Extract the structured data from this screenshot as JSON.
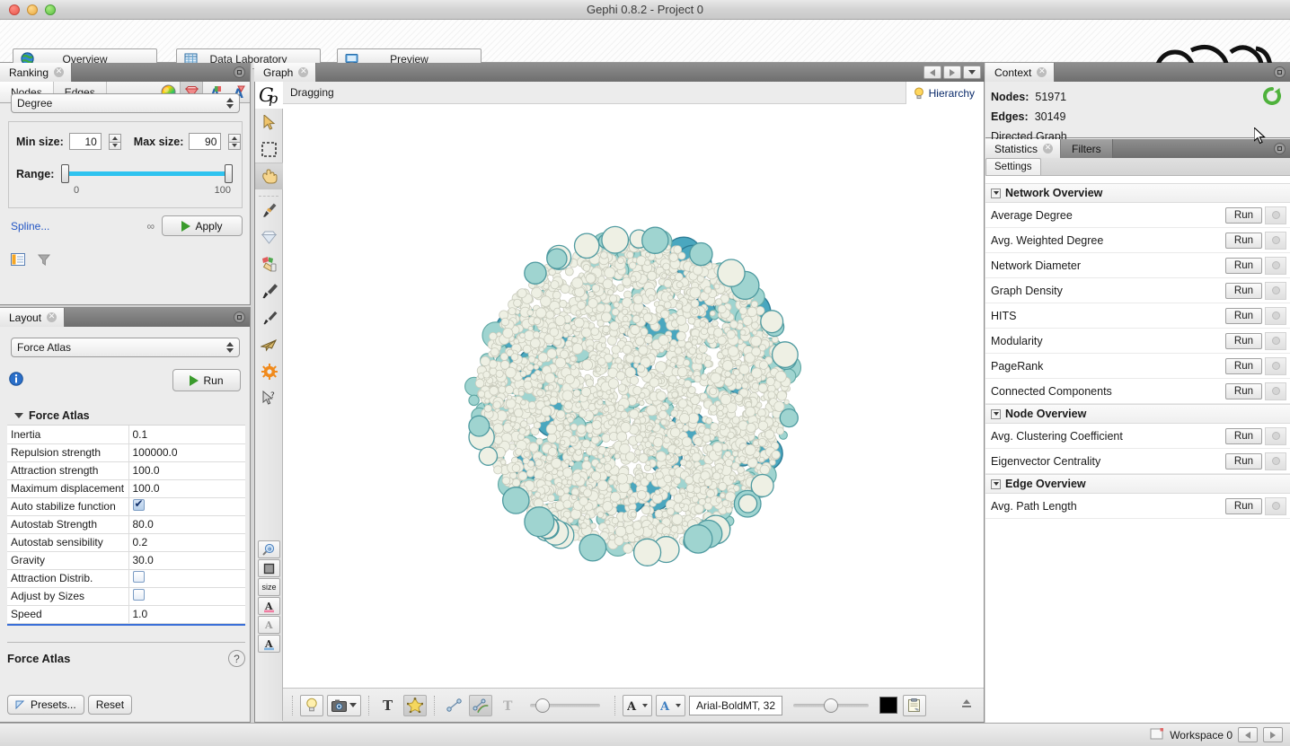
{
  "window": {
    "title": "Gephi 0.8.2 - Project 0"
  },
  "toolbar": {
    "modes": [
      {
        "label": "Overview",
        "icon": "globe-icon"
      },
      {
        "label": "Data Laboratory",
        "icon": "table-icon"
      },
      {
        "label": "Preview",
        "icon": "monitor-icon"
      }
    ]
  },
  "ranking": {
    "tab_label": "Ranking",
    "subtabs": [
      {
        "label": "Nodes",
        "selected": true
      },
      {
        "label": "Edges",
        "selected": false
      }
    ],
    "icons": [
      {
        "name": "color-wheel-icon",
        "active": false
      },
      {
        "name": "diamond-size-icon",
        "active": true
      },
      {
        "name": "label-color-icon",
        "active": false
      },
      {
        "name": "label-size-icon",
        "active": false
      }
    ],
    "attribute": "Degree",
    "min_size_label": "Min size:",
    "min_size_value": "10",
    "max_size_label": "Max size:",
    "max_size_value": "90",
    "range_label": "Range:",
    "range_min": "0",
    "range_max": "100",
    "spline_label": "Spline...",
    "apply_label": "Apply"
  },
  "layout": {
    "tab_label": "Layout",
    "algorithm": "Force Atlas",
    "run_label": "Run",
    "group_label": "Force Atlas",
    "properties": [
      {
        "key": "Inertia",
        "value": "0.1",
        "type": "text"
      },
      {
        "key": "Repulsion strength",
        "value": "100000.0",
        "type": "text"
      },
      {
        "key": "Attraction strength",
        "value": "100.0",
        "type": "text"
      },
      {
        "key": "Maximum displacement",
        "value": "100.0",
        "type": "text"
      },
      {
        "key": "Auto stabilize function",
        "value": "",
        "type": "checkbox",
        "checked": true
      },
      {
        "key": "Autostab Strength",
        "value": "80.0",
        "type": "text"
      },
      {
        "key": "Autostab sensibility",
        "value": "0.2",
        "type": "text"
      },
      {
        "key": "Gravity",
        "value": "30.0",
        "type": "text"
      },
      {
        "key": "Attraction Distrib.",
        "value": "",
        "type": "checkbox",
        "checked": false
      },
      {
        "key": "Adjust by Sizes",
        "value": "",
        "type": "checkbox",
        "checked": false
      },
      {
        "key": "Speed",
        "value": "1.0",
        "type": "text"
      }
    ],
    "info_title": "Force Atlas",
    "help_label": "?",
    "presets_label": "Presets...",
    "reset_label": "Reset"
  },
  "graph": {
    "tab_label": "Graph",
    "status_text": "Dragging",
    "hierarchy_label": "Hierarchy",
    "tools": [
      {
        "name": "gephi-g-icon",
        "selected": false
      },
      {
        "name": "cursor-select-icon",
        "selected": false
      },
      {
        "name": "rectangle-selection-icon",
        "selected": false
      },
      {
        "name": "hand-drag-icon",
        "selected": true
      },
      {
        "name": "brush-paint-icon",
        "selected": false
      },
      {
        "name": "diamond-size-tool-icon",
        "selected": false
      },
      {
        "name": "color-paint-icon",
        "selected": false
      },
      {
        "name": "pencil-edit-icon",
        "selected": false
      },
      {
        "name": "pencil-small-icon",
        "selected": false
      },
      {
        "name": "airplane-icon",
        "selected": false
      },
      {
        "name": "gear-orange-icon",
        "selected": false
      },
      {
        "name": "cursor-help-icon",
        "selected": false
      }
    ],
    "lower_tools": [
      {
        "name": "zoom-magnifier-icon",
        "label": ""
      },
      {
        "name": "node-square-icon",
        "label": ""
      },
      {
        "name": "size-label-icon",
        "label": "size"
      },
      {
        "name": "label-color-a-icon",
        "label": "A"
      },
      {
        "name": "label-grey-a-icon",
        "label": "A"
      },
      {
        "name": "label-blue-a-icon",
        "label": "A"
      }
    ],
    "bottom_bar": {
      "lightbulb_icon": "lightbulb-icon",
      "screenshot_icon": "camera-icon",
      "dropdown_icon": "chevron-down-icon",
      "node_labels_icon": "big-T-icon",
      "node_shape_icon": "yellow-star-icon",
      "edge_icon": "edge-line-icon",
      "edge_color_icon": "rainbow-edge-icon",
      "edge_labels_icon": "grey-T-icon",
      "label_size_slider": 12,
      "font_a_dark_icon": "font-a-dark-icon",
      "font_a_blue_icon": "font-a-blue-icon",
      "font_value": "Arial-BoldMT, 32",
      "opacity_slider": 50,
      "color_swatch": "#000000",
      "settings_icon": "settings-clipboard-icon",
      "export_icon": "export-icon"
    }
  },
  "context": {
    "tab_label": "Context",
    "nodes_label": "Nodes:",
    "nodes_value": "51971",
    "edges_label": "Edges:",
    "edges_value": "30149",
    "graph_type": "Directed Graph",
    "refresh_icon": "refresh-green-icon"
  },
  "statistics": {
    "tab_label": "Statistics",
    "filters_tab_label": "Filters",
    "settings_tab_label": "Settings",
    "run_label": "Run",
    "groups": [
      {
        "title": "Network Overview",
        "items": [
          "Average Degree",
          "Avg. Weighted Degree",
          "Network Diameter",
          "Graph Density",
          "HITS",
          "Modularity",
          "PageRank",
          "Connected Components"
        ]
      },
      {
        "title": "Node Overview",
        "items": [
          "Avg. Clustering Coefficient",
          "Eigenvector Centrality"
        ]
      },
      {
        "title": "Edge Overview",
        "items": [
          "Avg. Path Length"
        ]
      }
    ]
  },
  "statusbar": {
    "workspace_label": "Workspace 0"
  },
  "colors": {
    "accent_blue": "#2fc3ef",
    "node_light": "#eef0e4",
    "node_teal": "#9fd4d0",
    "node_deep_teal": "#4aa7bf",
    "link_blue": "#2457c5",
    "run_green": "#3a9b2c"
  }
}
